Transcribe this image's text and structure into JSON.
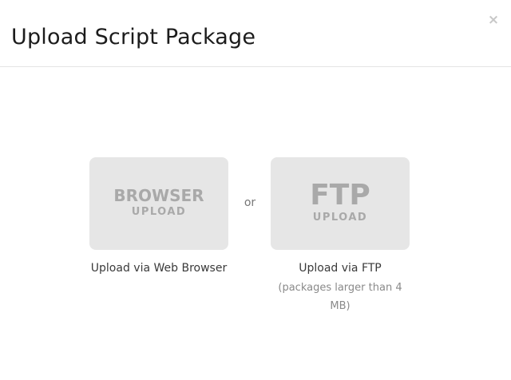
{
  "dialog": {
    "title": "Upload Script Package",
    "close_label": "×"
  },
  "options": {
    "browser": {
      "tile_big": "BROWSER",
      "tile_small": "UPLOAD",
      "caption": "Upload via Web Browser"
    },
    "separator": "or",
    "ftp": {
      "tile_big": "FTP",
      "tile_small": "UPLOAD",
      "caption": "Upload via FTP",
      "note_line1": "(packages larger than 4",
      "note_line2": "MB)"
    }
  }
}
